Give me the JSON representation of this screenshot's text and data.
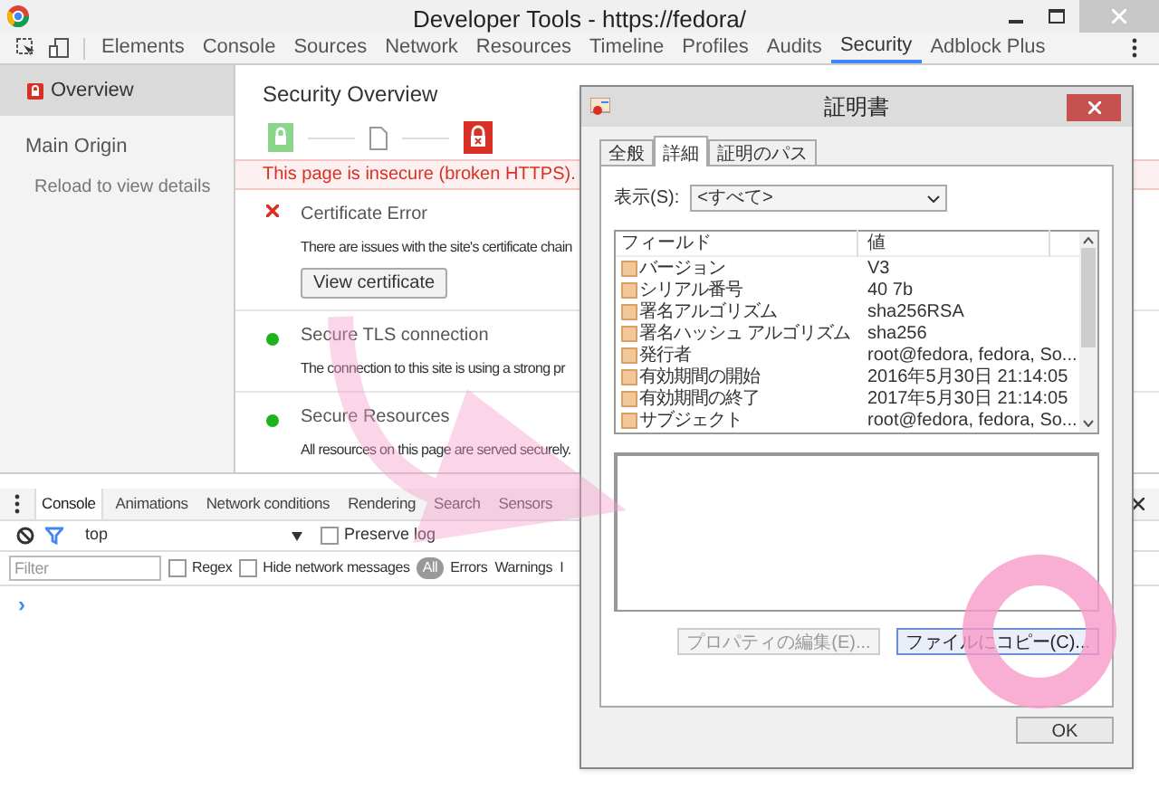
{
  "window": {
    "title": "Developer Tools - https://fedora/"
  },
  "toolbar": {
    "tabs": [
      {
        "label": "Elements",
        "selected": false
      },
      {
        "label": "Console",
        "selected": false
      },
      {
        "label": "Sources",
        "selected": false
      },
      {
        "label": "Network",
        "selected": false
      },
      {
        "label": "Resources",
        "selected": false
      },
      {
        "label": "Timeline",
        "selected": false
      },
      {
        "label": "Profiles",
        "selected": false
      },
      {
        "label": "Audits",
        "selected": false
      },
      {
        "label": "Security",
        "selected": true
      },
      {
        "label": "Adblock Plus",
        "selected": false
      }
    ]
  },
  "sidebar": {
    "overview": {
      "label": "Overview",
      "selected": true
    },
    "main_origin": "Main Origin",
    "reload_hint": "Reload to view details"
  },
  "security_overview": {
    "title": "Security Overview",
    "banner": "This page is insecure (broken HTTPS).",
    "items": [
      {
        "kind": "error",
        "title": "Certificate Error",
        "description": "There are issues with the site's certificate chain",
        "button": "View certificate"
      },
      {
        "kind": "secure",
        "title": "Secure TLS connection",
        "description": "The connection to this site is using a strong pr"
      },
      {
        "kind": "secure",
        "title": "Secure Resources",
        "description": "All resources on this page are served securely."
      }
    ]
  },
  "drawer": {
    "tabs": [
      {
        "label": "Console",
        "selected": true
      },
      {
        "label": "Animations",
        "selected": false
      },
      {
        "label": "Network conditions",
        "selected": false
      },
      {
        "label": "Rendering",
        "selected": false
      },
      {
        "label": "Search",
        "selected": false
      },
      {
        "label": "Sensors",
        "selected": false
      }
    ],
    "context": "top",
    "preserve_log": {
      "label": "Preserve log",
      "checked": false
    },
    "filter": {
      "placeholder": "Filter"
    },
    "regex": {
      "label": "Regex",
      "checked": false
    },
    "hide_network": {
      "label": "Hide network messages",
      "checked": false
    },
    "levels": [
      {
        "label": "All",
        "selected": true
      },
      {
        "label": "Errors",
        "selected": false
      },
      {
        "label": "Warnings",
        "selected": false
      },
      {
        "label": "I",
        "selected": false
      }
    ],
    "prompt": "›"
  },
  "dialog": {
    "title": "証明書",
    "tabs": [
      {
        "label": "全般",
        "selected": false
      },
      {
        "label": "詳細",
        "selected": true
      },
      {
        "label": "証明のパス",
        "selected": false
      }
    ],
    "show_label": "表示(S):",
    "show_value": "<すべて>",
    "columns": [
      "フィールド",
      "値"
    ],
    "rows": [
      {
        "field": "バージョン",
        "value": "V3"
      },
      {
        "field": "シリアル番号",
        "value": "40 7b"
      },
      {
        "field": "署名アルゴリズム",
        "value": "sha256RSA"
      },
      {
        "field": "署名ハッシュ アルゴリズム",
        "value": "sha256"
      },
      {
        "field": "発行者",
        "value": "root@fedora, fedora, So..."
      },
      {
        "field": "有効期間の開始",
        "value": "2016年5月30日 21:14:05"
      },
      {
        "field": "有効期間の終了",
        "value": "2017年5月30日 21:14:05"
      },
      {
        "field": "サブジェクト",
        "value": "root@fedora, fedora, So..."
      }
    ],
    "buttons": [
      {
        "label": "プロパティの編集(E)...",
        "disabled": true
      },
      {
        "label": "ファイルにコピー(C)...",
        "disabled": false
      }
    ],
    "ok": "OK"
  }
}
